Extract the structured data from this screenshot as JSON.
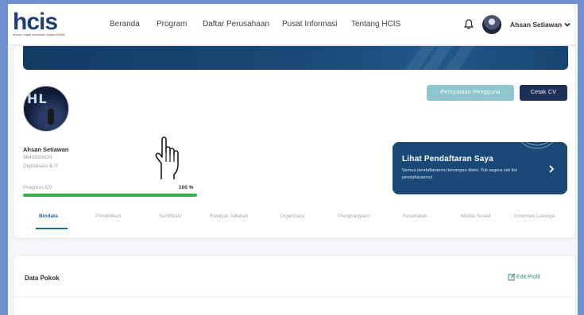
{
  "header": {
    "logo_text": "hcis",
    "logo_tagline": "Human Capital Information System BUMN",
    "nav": [
      "Beranda",
      "Program",
      "Daftar Perusahaan",
      "Pusat Informasi",
      "Tentang HCIS"
    ],
    "user_name": "Ahsan Setiawan"
  },
  "profile": {
    "name": "Ahsan Setiawan",
    "id": "9643920ICN",
    "department": "Digitalisasi & IT",
    "progress_label": "Progress CV",
    "progress_text": "100 %",
    "progress_fraction": 1.0,
    "avatar_letters": "HL"
  },
  "actions": {
    "pernyataan_label": "Pernyataan Pengguna",
    "cetak_label": "Cetak CV"
  },
  "promo": {
    "title": "Lihat Pendaftaran Saya",
    "description": "Semua pendaftaranmu tersimpan disini. Yuk segera cek list pendaftaranmu!"
  },
  "tabs": [
    "Biodata",
    "Pendidikan",
    "Sertifikasi",
    "Riwayat Jabatan",
    "Organisasi",
    "Penghargaan",
    "Kesehatan",
    "Media Sosial",
    "Informasi Lainnya"
  ],
  "active_tab": "Biodata",
  "data_pokok": {
    "title": "Data Pokok",
    "edit_label": "Edit Profil"
  },
  "colors": {
    "primary_dark": "#1c2f58",
    "banner": "#1a4978",
    "progress": "#35b14a",
    "accent": "#1f6b8f",
    "frame": "#6f8fd0"
  },
  "icons": [
    "bell-icon",
    "chevron-down-icon",
    "chevron-right-icon",
    "edit-icon",
    "hand-pointer-icon"
  ]
}
